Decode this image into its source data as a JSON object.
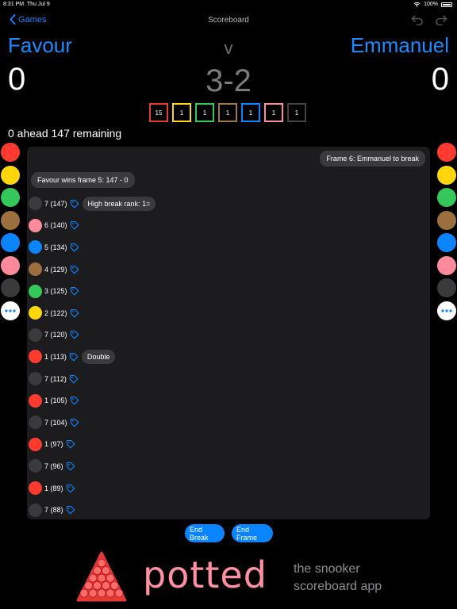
{
  "status": {
    "time": "8:31 PM",
    "date": "Thu Jul 9",
    "battery": "100%"
  },
  "nav": {
    "back_label": "Games",
    "title": "Scoreboard"
  },
  "match": {
    "player1": {
      "name": "Favour",
      "score": "0"
    },
    "player2": {
      "name": "Emmanuel",
      "score": "0"
    },
    "vs": "v",
    "frames": "3-2"
  },
  "remaining_boxes": [
    {
      "value": "15",
      "color": "#e53935"
    },
    {
      "value": "1",
      "color": "#ffd60a"
    },
    {
      "value": "1",
      "color": "#34c759"
    },
    {
      "value": "1",
      "color": "#a0764a"
    },
    {
      "value": "1",
      "color": "#0a84ff"
    },
    {
      "value": "1",
      "color": "#ff8a9b"
    },
    {
      "value": "1",
      "color": "#444444"
    }
  ],
  "ahead_text": "0 ahead  147 remaining",
  "side_balls": [
    "#ff3b30",
    "#ffd60a",
    "#34c759",
    "#9c6f3e",
    "#0a84ff",
    "#ff8a9b",
    "#3a3a3c"
  ],
  "panel": {
    "frame_msg": "Frame 6: Emmanuel to break",
    "win_msg": "Favour wins frame 5: 147 - 0"
  },
  "pots": [
    {
      "text": "7 (147)",
      "color": "#3a3a3c",
      "note": "High break rank: 1="
    },
    {
      "text": "6 (140)",
      "color": "#ff8a9b",
      "note": ""
    },
    {
      "text": "5 (134)",
      "color": "#0a84ff",
      "note": ""
    },
    {
      "text": "4 (129)",
      "color": "#9c6f3e",
      "note": ""
    },
    {
      "text": "3 (125)",
      "color": "#34c759",
      "note": ""
    },
    {
      "text": "2 (122)",
      "color": "#ffd60a",
      "note": ""
    },
    {
      "text": "7 (120)",
      "color": "#3a3a3c",
      "note": ""
    },
    {
      "text": "1 (113)",
      "color": "#ff3b30",
      "note": "Double"
    },
    {
      "text": "7 (112)",
      "color": "#3a3a3c",
      "note": ""
    },
    {
      "text": "1 (105)",
      "color": "#ff3b30",
      "note": ""
    },
    {
      "text": "7 (104)",
      "color": "#3a3a3c",
      "note": ""
    },
    {
      "text": "1 (97)",
      "color": "#ff3b30",
      "note": ""
    },
    {
      "text": "7 (96)",
      "color": "#3a3a3c",
      "note": ""
    },
    {
      "text": "1 (89)",
      "color": "#ff3b30",
      "note": ""
    },
    {
      "text": "7 (88)",
      "color": "#3a3a3c",
      "note": ""
    }
  ],
  "buttons": {
    "end_break": "End Break",
    "end_frame": "End Frame"
  },
  "brand": {
    "logo": "potted",
    "tagline1": "the snooker",
    "tagline2": "scoreboard app"
  }
}
